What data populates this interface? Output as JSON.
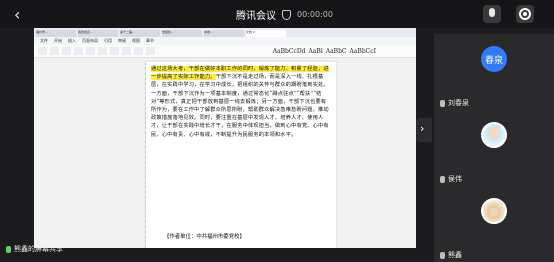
{
  "header": {
    "back_icon": "‹",
    "title": "腾讯会议",
    "timer": "00:00:00",
    "mic_icon": "mic-icon",
    "record_icon": "record-icon"
  },
  "shared_screen": {
    "tabs": [
      "福州市...",
      "我的会议...",
      "第十二届...",
      "党组织...",
      "本地...",
      "文档 2"
    ],
    "menus": [
      "文件",
      "开始",
      "插入",
      "页面布局",
      "引用",
      "审阅",
      "视图",
      "章节"
    ],
    "styles": [
      "AaBbCcDd",
      "AaBl",
      "AaBbC",
      "AaBbCcI"
    ],
    "paragraph_pre": "",
    "paragraph_highlight": "通过这场大考，干部在做好本职工作的同时，锻炼了能力、积累了经验，进一步提高了实际工作能力。",
    "paragraph_rest": "干部下沉不是走过场，而是深入一线、扎根基层，在实践中学习，在学习中成长，把组织的关怀与群众的期盼落到实处。一方面，干部下沉作为一项基本制度，通过常态化“蹲点驻点”“帮扶”“结对”等形式，真正把干部放到基层一线去锻炼；另一方面，干部下沉也要有所作为，要在工作中了解群众所思所盼，帮助群众解决急难愁盼问题，推动政策措施落地见效。同时，要注重在基层中发现人才、培养人才、使用人才，让干部在实践中增长才干，在服务中体现担当，做到心中有党、心中有民、心中有责、心中有戒，不断提升为民服务的本领和水平。",
    "signoff": "【作者单位：中共福州市委党校】"
  },
  "presenter": {
    "label": "熊鑫的屏幕共享"
  },
  "sidebar": {
    "toggle_icon": "›",
    "participants": [
      {
        "name": "刘春泉",
        "avatar_text": "春泉",
        "avatar": "blue"
      },
      {
        "name": "侯伟",
        "avatar_text": "",
        "avatar": "pic1"
      },
      {
        "name": "熊鑫",
        "avatar_text": "",
        "avatar": "pic2"
      }
    ]
  }
}
